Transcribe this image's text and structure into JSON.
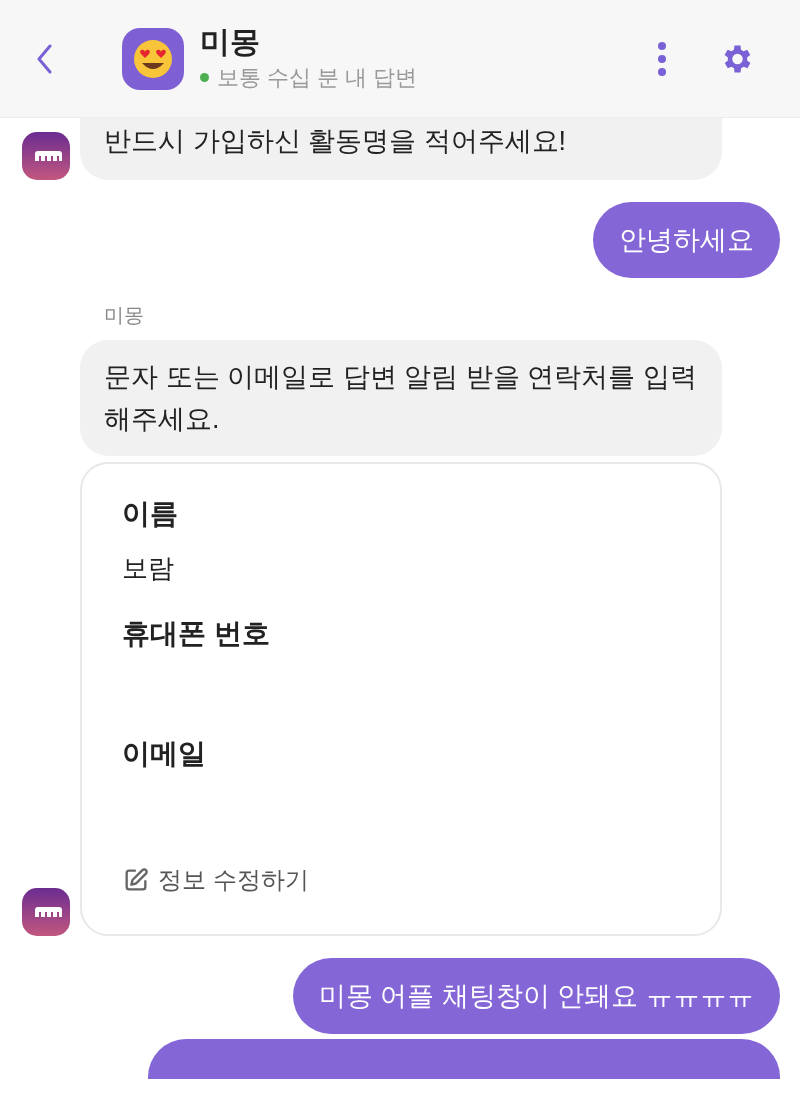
{
  "header": {
    "title": "미몽",
    "status": "보통 수십 분 내 답변",
    "online": true
  },
  "messages": [
    {
      "kind": "bot",
      "text": "반드시 가입하신 활동명을 적어주세요!",
      "cut_top": true,
      "show_avatar": true
    },
    {
      "kind": "user",
      "text": "안녕하세요"
    },
    {
      "kind": "bot",
      "sender": "미몽",
      "text": "문자 또는 이메일로 답변 알림 받을 연락처를 입력해주세요.",
      "cut_top": false,
      "show_avatar": false
    },
    {
      "kind": "form",
      "show_avatar": true,
      "fields": [
        {
          "label": "이름",
          "value": "보람"
        },
        {
          "label": "휴대폰 번호"
        },
        {
          "label": "이메일"
        }
      ],
      "edit_link": "정보 수정하기"
    },
    {
      "kind": "user",
      "text": "미몽 어플 채팅창이 안돼요 ㅠㅠㅠㅠ"
    },
    {
      "kind": "user_partial"
    }
  ]
}
